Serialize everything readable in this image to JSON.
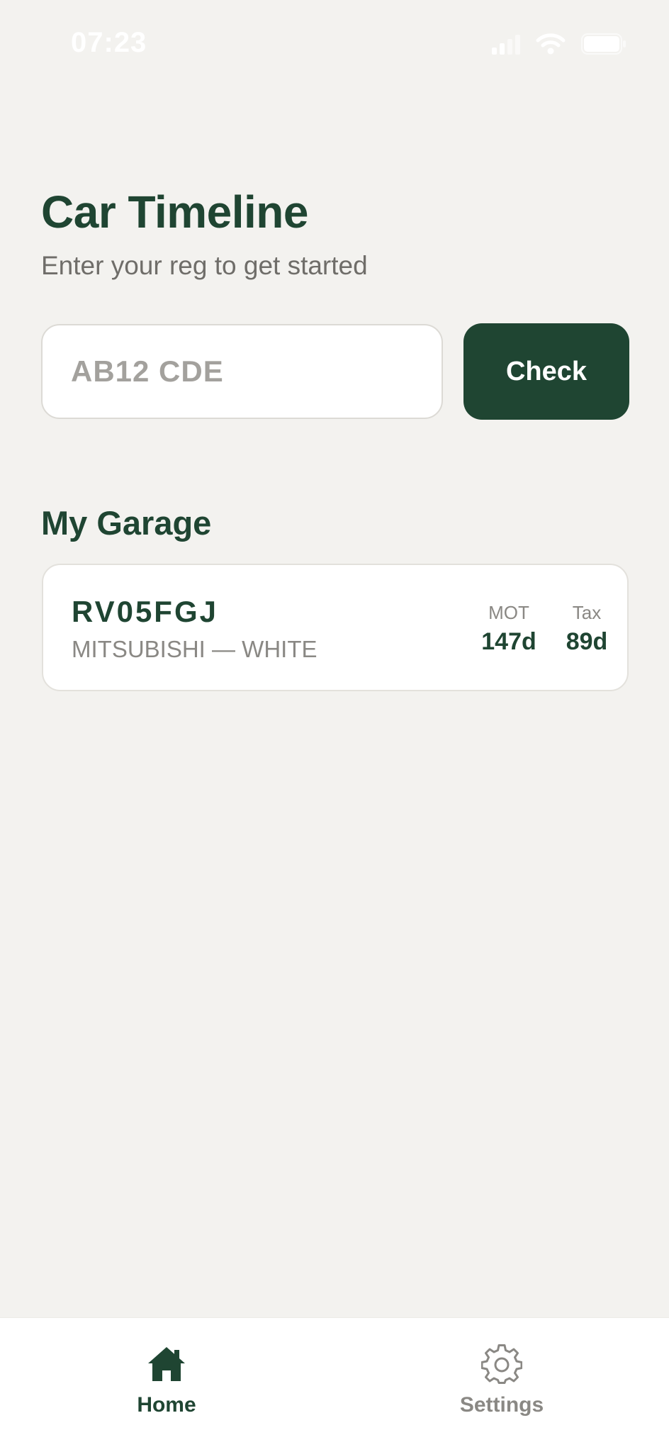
{
  "status_bar": {
    "time": "07:23"
  },
  "header": {
    "title": "Car Timeline",
    "subtitle": "Enter your reg to get started"
  },
  "search": {
    "placeholder": "AB12 CDE",
    "value": "",
    "button_label": "Check"
  },
  "garage": {
    "title": "My Garage",
    "vehicles": [
      {
        "reg": "RV05FGJ",
        "description": "MITSUBISHI — WHITE",
        "mot_label": "MOT",
        "mot_value": "147d",
        "tax_label": "Tax",
        "tax_value": "89d"
      }
    ]
  },
  "tab_bar": {
    "tabs": [
      {
        "label": "Home",
        "icon": "house-icon",
        "active": true
      },
      {
        "label": "Settings",
        "icon": "gear-icon",
        "active": false
      }
    ]
  },
  "colors": {
    "brand": "#1f4532",
    "background": "#f3f2ef",
    "muted_text": "#8a8884"
  }
}
